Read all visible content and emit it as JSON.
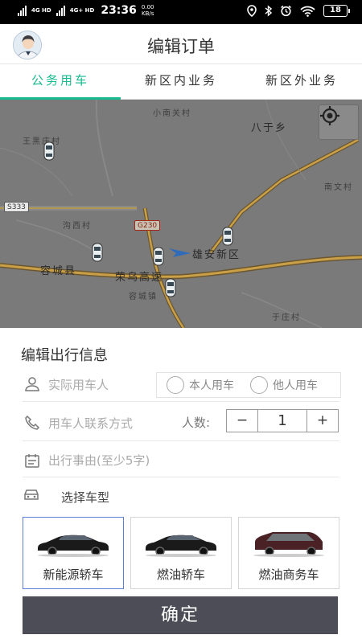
{
  "status_bar": {
    "network_1": "4G HD",
    "network_2": "4G+ HD",
    "time": "23:36",
    "speed_value": "0.00",
    "speed_unit": "KB/s",
    "battery": "18",
    "icons": [
      "location-icon",
      "bluetooth-icon",
      "alarm-icon",
      "wifi-icon",
      "battery-icon"
    ]
  },
  "header": {
    "title": "编辑订单",
    "avatar_icon": "user-avatar"
  },
  "tabs": [
    {
      "label": "公务用车",
      "active": true
    },
    {
      "label": "新区内业务",
      "active": false
    },
    {
      "label": "新区外业务",
      "active": false
    }
  ],
  "map": {
    "labels": {
      "xiaonanzhuang": "小南关村",
      "baqixiang": "八于乡",
      "wangjiazhuang": "王黑庄村",
      "nanwencun": "南文村",
      "goudicun": "沟西村",
      "rongchengxian": "容城县",
      "rongwugaosu": "荣乌高速",
      "xionganxinqu": "雄安新区",
      "rongchengzhen": "容城镇",
      "yuzhuangcun": "于庄村"
    },
    "road_badges": {
      "s333": "S333",
      "g230": "G230"
    },
    "locate_icon": "locate-icon"
  },
  "form": {
    "section_title": "编辑出行信息",
    "actual_user_placeholder": "实际用车人",
    "radio_self": "本人用车",
    "radio_other": "他人用车",
    "contact_placeholder": "用车人联系方式",
    "people_label": "人数:",
    "people_count": "1",
    "minus": "−",
    "plus": "+",
    "reason_placeholder": "出行事由(至少5字)",
    "car_type_label": "选择车型"
  },
  "car_types": [
    {
      "label": "新能源轿车",
      "selected": true,
      "color": "#1a1a1a"
    },
    {
      "label": "燃油轿车",
      "selected": false,
      "color": "#1a1a1a"
    },
    {
      "label": "燃油商务车",
      "selected": false,
      "color": "#4a2226"
    }
  ],
  "confirm_label": "确定",
  "colors": {
    "accent": "#17b98f",
    "confirm_bg": "#4c4d57",
    "selected_border": "#5b7fd6"
  }
}
